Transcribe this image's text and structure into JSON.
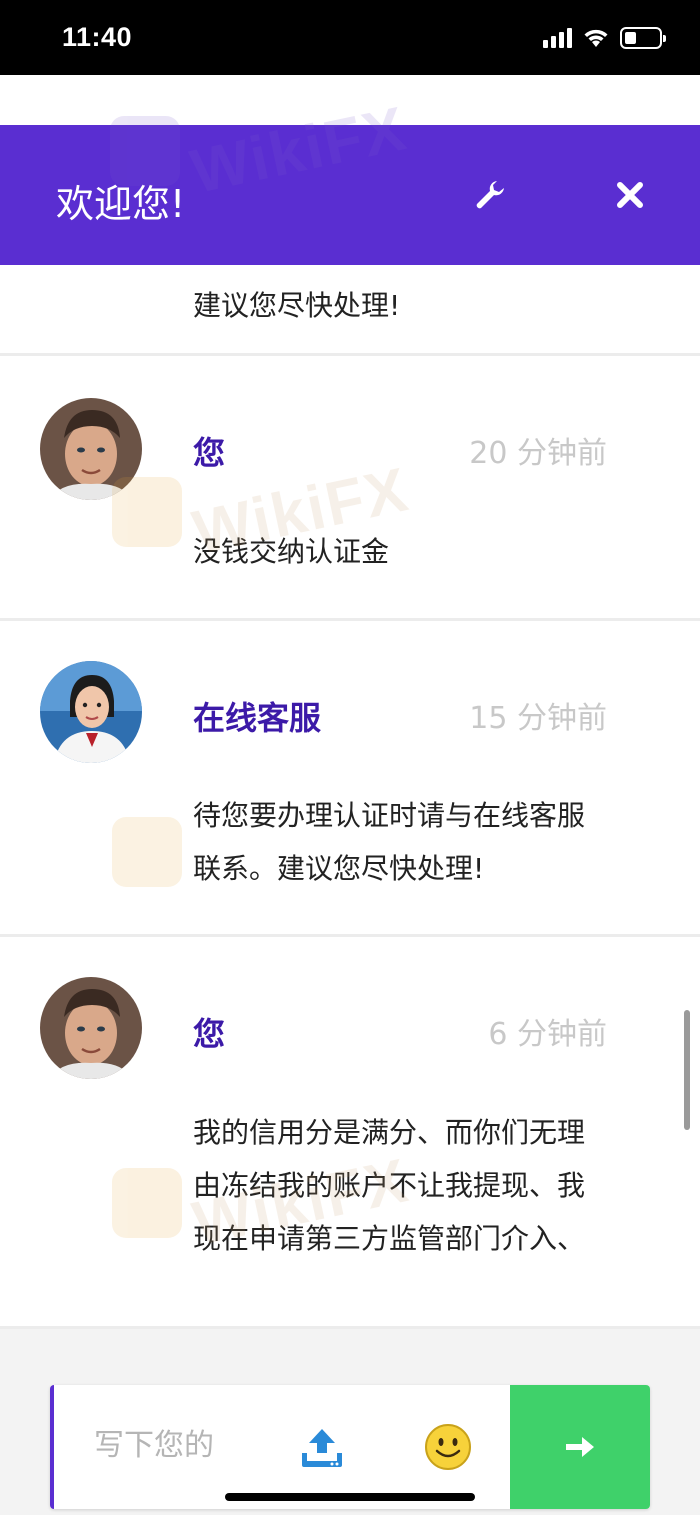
{
  "status_bar": {
    "time": "11:40"
  },
  "header": {
    "title": "欢迎您!",
    "wrench_icon": "wrench-icon",
    "close_icon": "close-icon",
    "accent": "#5a2ed1"
  },
  "watermark": {
    "text": "WikiFX"
  },
  "messages": [
    {
      "text": "建议您尽快处理!"
    },
    {
      "sender": "您",
      "time": "20 分钟前",
      "text": "没钱交纳认证金",
      "avatar": "male-avatar"
    },
    {
      "sender": "在线客服",
      "time": "15 分钟前",
      "text": "待您要办理认证时请与在线客服联系。建议您尽快处理!",
      "avatar": "agent-avatar"
    },
    {
      "sender": "您",
      "time": "6 分钟前",
      "text": "我的信用分是满分、而你们无理由冻结我的账户不让我提现、我现在申请第三方监管部门介入、",
      "avatar": "male-avatar"
    }
  ],
  "composer": {
    "placeholder": "写下您的",
    "upload_icon": "upload-icon",
    "emoji_icon": "smiley-icon",
    "send_icon": "arrow-right-icon",
    "send_color": "#3fd16a"
  }
}
